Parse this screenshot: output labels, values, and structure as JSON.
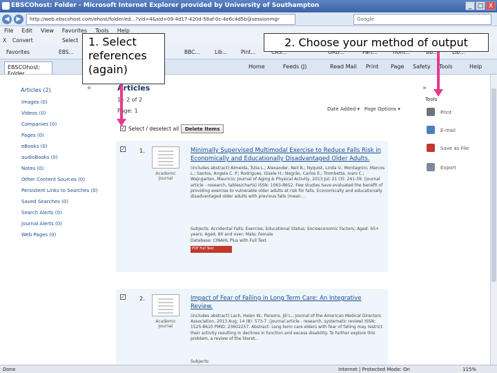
{
  "window": {
    "title": "EBSCOhost: Folder - Microsoft Internet Explorer provided by University of Southampton",
    "controls": [
      "_",
      "□",
      "X"
    ]
  },
  "address": {
    "url": "http://web.ebscohost.com/ehost/folder/ed...?vid=4&sid=09-4d17-420d-58af-0c-4e6c4d5b@sessionmgr",
    "search_placeholder": "Google"
  },
  "menu": [
    "File",
    "Edit",
    "View",
    "Favorites",
    "Tools",
    "Help"
  ],
  "links_bar": {
    "convert": "Convert",
    "select": "Select",
    "x_label": "X"
  },
  "favorites_bar": {
    "favorites": "Favorites",
    "items": [
      "EBS...",
      "BBC...",
      "Lib...",
      "Pint...",
      "CAS...",
      "ORD...",
      "Part...",
      "Hom...",
      "BB...",
      "Lib..."
    ]
  },
  "tab": {
    "label": "EBSCOhost: Folder"
  },
  "command_bar": [
    "Home",
    "Feeds (J)",
    "Read Mail",
    "Print",
    "Page",
    "Safety",
    "Tools",
    "Help"
  ],
  "left_nav": {
    "header": "Articles (2)",
    "collapse": "«",
    "items": [
      "Images (0)",
      "Videos (0)",
      "Companies (0)",
      "Pages (0)",
      "eBooks (0)",
      "audioBooks (0)",
      "Notes (0)",
      "Other Content Sources (0)",
      "Persistent Links to Searches (0)",
      "Saved Searches (0)",
      "Search Alerts (0)",
      "Journal Alerts (0)",
      "Web Pages (0)"
    ]
  },
  "main": {
    "title": "Articles",
    "range": "1 - 2 of 2",
    "page": "Page: 1",
    "sort_date": "Date Added ▾",
    "page_options": "Page Options ▾",
    "select_all": "Select / deselect all",
    "delete_button": "Delete Items",
    "expand": "»"
  },
  "records": [
    {
      "number": "1.",
      "title": "Minimally Supervised Multimodal Exercise to Reduce Falls Risk in Economically and Educationally Disadvantaged Older Adults.",
      "pub_type": "Academic Journal",
      "text": "(includes abstract) Almeida, Tulia L.; Alexander, Neil B.; Nyquist, Linda V.; Montagnini, Marcos L.; Santos, Angela C. P.; Rodrigues, Gisele H.; Negrão, Carlos E.; Trombetta, Ivani C.; Wajngarten, Mauricio; Journal of Aging & Physical Activity, 2013 Jul; 21 (3): 241-59. (journal article - research, tables/charts) ISSN: 1063-8652. Few studies have evaluated the benefit of providing exercise to vulnerable older adults at risk for falls. Economically and educationally disadvantaged older adults with previous falls (mean...",
      "subjects": "Subjects: Accidental Falls; Exercise; Educational Status; Socioeconomic Factors; Aged: 65+ years; Aged, 80 and over; Male; Female",
      "database": "Database: CINAHL Plus with Full Text",
      "pdf_badge": "PDF Full Text"
    },
    {
      "number": "2.",
      "title": "Impact of Fear of Falling in Long Term Care: An Integrative Review.",
      "pub_type": "Academic Journal",
      "text": "(includes abstract) Lach, Helen W.; Parsons, Jill L.; Journal of the American Medical Directors Association, 2013 Aug; 14 (8): 573-7. (journal article - research, systematic review) ISSN: 1525-8610 PMID: 23602257. Abstract: Long term care elders with fear of falling may restrict their activity resulting in declines in function and excess disability. To further explore this problem, a review of the literat...",
      "subjects": "Subjects:"
    }
  ],
  "tools": {
    "header": "Tools",
    "items": [
      {
        "label": "Print",
        "icon": "printer-icon",
        "color": "#6b7480"
      },
      {
        "label": "E-mail",
        "icon": "email-icon",
        "color": "#4a7fc1"
      },
      {
        "label": "Save as File",
        "icon": "save-icon",
        "color": "#c0392b"
      },
      {
        "label": "Export",
        "icon": "export-icon",
        "color": "#7b8a9c"
      }
    ]
  },
  "callouts": {
    "step1": "1. Select references (again)",
    "step2": "2. Choose your method of output",
    "arrow_color": "#e8398e"
  },
  "status": {
    "left": "Done",
    "zone": "Internet | Protected Mode: On",
    "zoom": "115%"
  }
}
